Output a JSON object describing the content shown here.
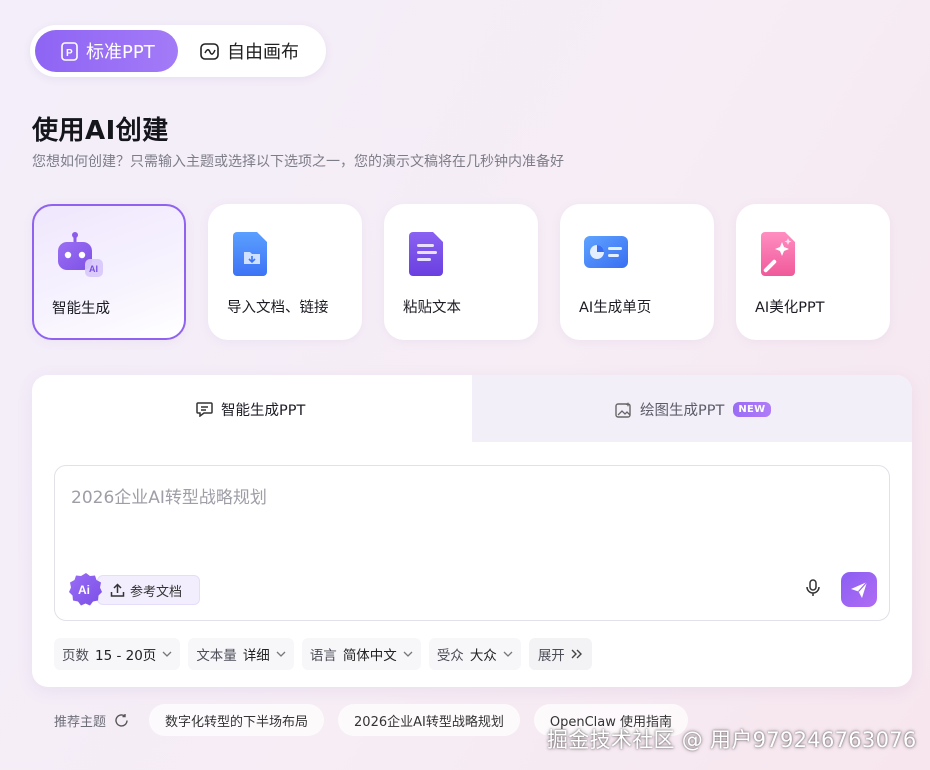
{
  "mode_switch": {
    "standard_label": "标准PPT",
    "free_label": "自由画布"
  },
  "header": {
    "title": "使用AI创建",
    "subtitle": "您想如何创建？只需输入主题或选择以下选项之一，您的演示文稿将在几秒钟内准备好"
  },
  "cards": [
    {
      "label": "智能生成",
      "icon": "robot-icon",
      "selected": true
    },
    {
      "label": "导入文档、链接",
      "icon": "import-doc-icon"
    },
    {
      "label": "粘贴文本",
      "icon": "paste-text-icon"
    },
    {
      "label": "AI生成单页",
      "icon": "single-page-icon"
    },
    {
      "label": "AI美化PPT",
      "icon": "beautify-icon"
    }
  ],
  "tabs": {
    "smart": "智能生成PPT",
    "drawing": "绘图生成PPT",
    "new_badge": "NEW"
  },
  "input": {
    "placeholder": "2026企业AI转型战略规划",
    "ai_badge": "Ai",
    "ref_doc": "参考文档"
  },
  "options": {
    "pages_label": "页数",
    "pages_value": "15 - 20页",
    "text_label": "文本量",
    "text_value": "详细",
    "lang_label": "语言",
    "lang_value": "简体中文",
    "audience_label": "受众",
    "audience_value": "大众",
    "expand": "展开"
  },
  "recommend": {
    "label": "推荐主题",
    "chips": [
      "数字化转型的下半场布局",
      "2026企业AI转型战略规划",
      "OpenClaw 使用指南"
    ]
  },
  "watermark": "掘金技术社区 @ 用户979246763076",
  "colors": {
    "accent": "#8f63ef",
    "accent_light": "#a37bf7"
  }
}
